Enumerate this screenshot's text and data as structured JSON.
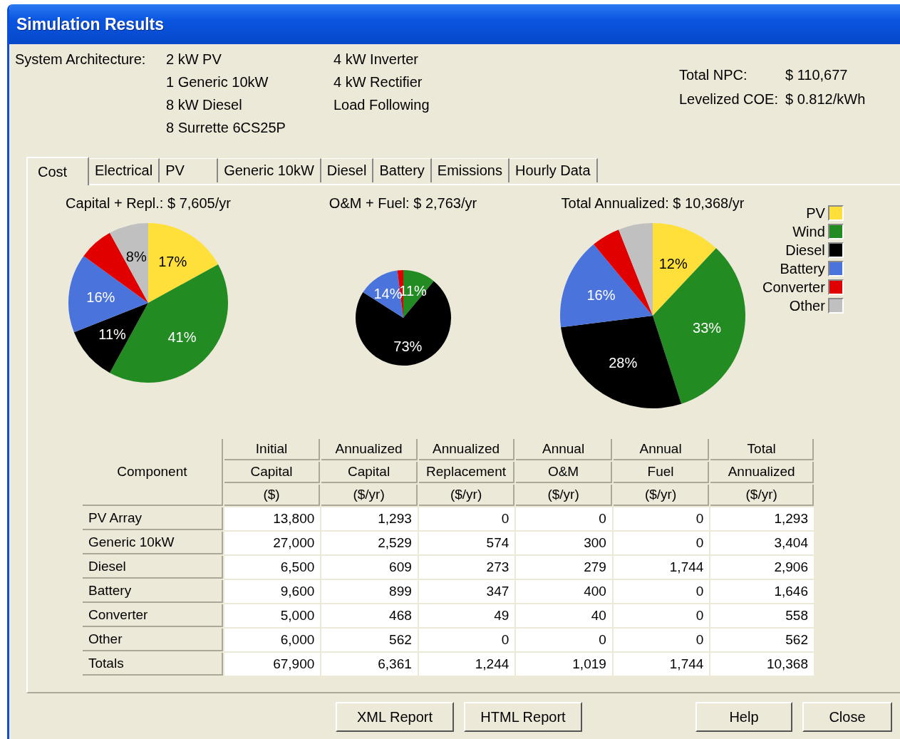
{
  "window": {
    "title": "Simulation Results"
  },
  "architecture": {
    "label": "System Architecture:",
    "column_1": [
      "2 kW PV",
      "1 Generic 10kW",
      "8 kW Diesel",
      "8 Surrette 6CS25P"
    ],
    "column_2": [
      "4 kW Inverter",
      "4 kW Rectifier",
      "Load Following"
    ]
  },
  "summary": [
    {
      "label": "Total NPC:",
      "value": "$ 110,677"
    },
    {
      "label": "Levelized COE:",
      "value": "$ 0.812/kWh"
    }
  ],
  "tabs": [
    {
      "label": "Cost",
      "selected": true
    },
    {
      "label": "Electrical",
      "selected": false
    },
    {
      "label": "PV",
      "selected": false
    },
    {
      "label": "Generic 10kW",
      "selected": false
    },
    {
      "label": "Diesel",
      "selected": false
    },
    {
      "label": "Battery",
      "selected": false
    },
    {
      "label": "Emissions",
      "selected": false
    },
    {
      "label": "Hourly Data",
      "selected": false
    }
  ],
  "charts": [
    {
      "chart_data": {
        "type": "pie",
        "title": "Capital + Repl.: $ 7,605/yr",
        "values": [
          17,
          41,
          11,
          16,
          7,
          8
        ],
        "value_labels": [
          "17%",
          "41%",
          "11%",
          "16%",
          null,
          "8%"
        ]
      }
    },
    {
      "chart_data": {
        "type": "pie",
        "title": "O&M + Fuel: $ 2,763/yr",
        "values": [
          0,
          11,
          73,
          14,
          2,
          0
        ],
        "value_labels": [
          null,
          "11%",
          "73%",
          "14%",
          null,
          null
        ]
      }
    },
    {
      "chart_data": {
        "type": "pie",
        "title": "Total Annualized: $ 10,368/yr",
        "values": [
          12,
          33,
          28,
          16,
          5,
          6
        ],
        "value_labels": [
          "12%",
          "33%",
          "28%",
          "16%",
          null,
          null
        ]
      }
    }
  ],
  "legend": [
    {
      "label": "PV",
      "color": "#ffe03a"
    },
    {
      "label": "Wind",
      "color": "#228b22"
    },
    {
      "label": "Diesel",
      "color": "#000000"
    },
    {
      "label": "Battery",
      "color": "#4a74dc"
    },
    {
      "label": "Converter",
      "color": "#e00000"
    },
    {
      "label": "Other",
      "color": "#c0c0c0"
    }
  ],
  "table": {
    "header_rows": [
      [
        {
          "text": "Component",
          "rowspan": 3
        },
        {
          "text": "Initial"
        },
        {
          "text": "Annualized"
        },
        {
          "text": "Annualized"
        },
        {
          "text": "Annual"
        },
        {
          "text": "Annual"
        },
        {
          "text": "Total"
        }
      ],
      [
        {
          "text": "Capital"
        },
        {
          "text": "Capital"
        },
        {
          "text": "Replacement"
        },
        {
          "text": "O&M"
        },
        {
          "text": "Fuel"
        },
        {
          "text": "Annualized"
        }
      ],
      [
        {
          "text": "($)"
        },
        {
          "text": "($/yr)"
        },
        {
          "text": "($/yr)"
        },
        {
          "text": "($/yr)"
        },
        {
          "text": "($/yr)"
        },
        {
          "text": "($/yr)"
        }
      ]
    ],
    "rows": [
      [
        "PV Array",
        "13,800",
        "1,293",
        "0",
        "0",
        "0",
        "1,293"
      ],
      [
        "Generic 10kW",
        "27,000",
        "2,529",
        "574",
        "300",
        "0",
        "3,404"
      ],
      [
        "Diesel",
        "6,500",
        "609",
        "273",
        "279",
        "1,744",
        "2,906"
      ],
      [
        "Battery",
        "9,600",
        "899",
        "347",
        "400",
        "0",
        "1,646"
      ],
      [
        "Converter",
        "5,000",
        "468",
        "49",
        "40",
        "0",
        "558"
      ],
      [
        "Other",
        "6,000",
        "562",
        "0",
        "0",
        "0",
        "562"
      ],
      [
        "Totals",
        "67,900",
        "6,361",
        "1,244",
        "1,019",
        "1,744",
        "10,368"
      ]
    ]
  },
  "buttons": [
    "XML Report",
    "HTML Report",
    "Help",
    "Close"
  ]
}
